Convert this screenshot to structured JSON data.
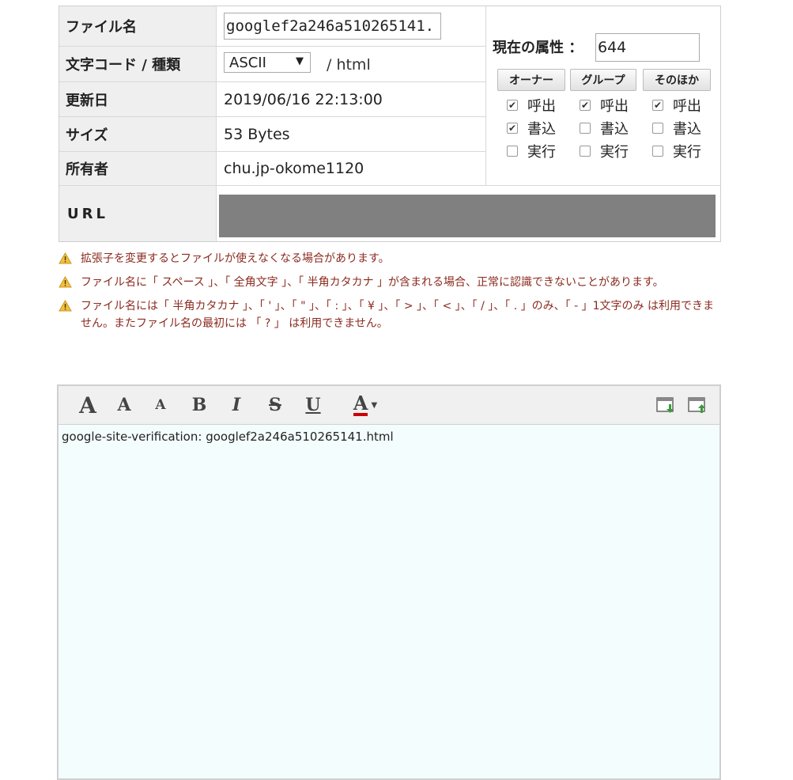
{
  "file": {
    "name_label": "ファイル名",
    "name_value": "googlef2a246a510265141.",
    "encoding_label": "文字コード / 種類",
    "encoding_value": "ASCII",
    "type_value": "/ html",
    "updated_label": "更新日",
    "updated_value": "2019/06/16 22:13:00",
    "size_label": "サイズ",
    "size_value": "53 Bytes",
    "owner_label": "所有者",
    "owner_value": "chu.jp-okome1120",
    "url_label": "URL"
  },
  "attributes": {
    "title": "現在の属性 ：",
    "value": "644",
    "roles": [
      {
        "label": "オーナー",
        "read": true,
        "write": true,
        "exec": false
      },
      {
        "label": "グループ",
        "read": true,
        "write": false,
        "exec": false
      },
      {
        "label": "そのほか",
        "read": true,
        "write": false,
        "exec": false
      }
    ],
    "read_label": "呼出",
    "write_label": "書込",
    "exec_label": "実行"
  },
  "warnings": [
    "拡張子を変更するとファイルが使えなくなる場合があります。",
    "ファイル名に「 スペース 」、「 全角文字 」、「 半角カタカナ 」が含まれる場合、正常に認識できないことがあります。",
    "ファイル名には「 半角カタカナ 」、「 ' 」、「 \" 」、「 : 」、「 ¥ 」、「 > 」、「 < 」、「 / 」、「 . 」のみ、「 - 」1文字のみ は利用できません。またファイル名の最初には 「 ? 」 は利用できません。"
  ],
  "toolbar": {
    "font_large": "A",
    "font_medium": "A",
    "font_small": "A",
    "bold": "B",
    "italic": "I",
    "strike": "S",
    "underline": "U",
    "color": "A",
    "color_swatch": "#cc0000"
  },
  "editor": {
    "content": "google-site-verification: googlef2a246a510265141.html"
  }
}
